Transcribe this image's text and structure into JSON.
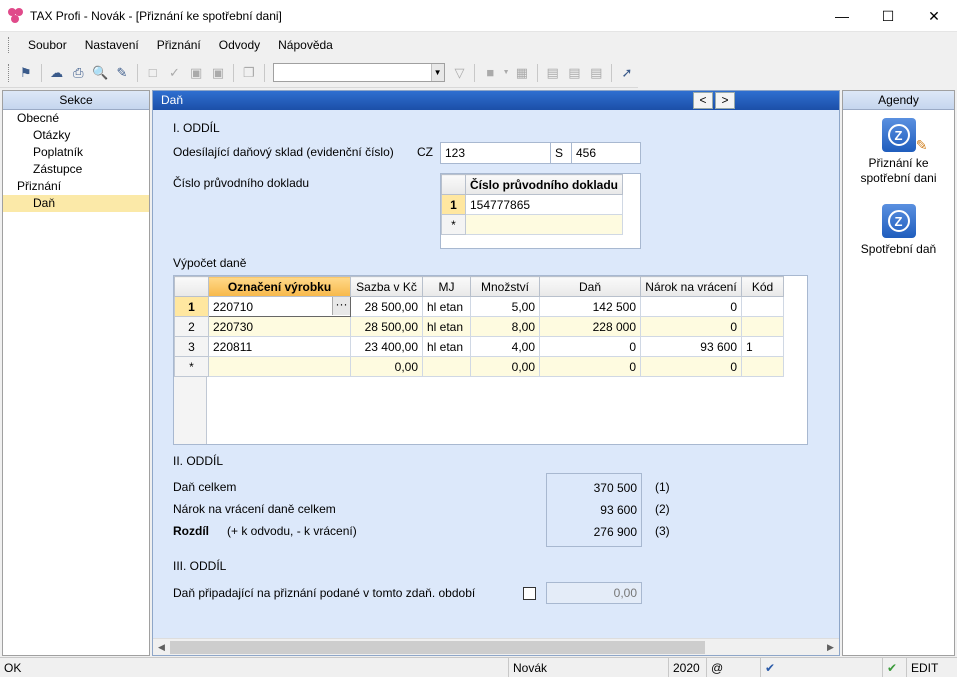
{
  "window": {
    "title": "TAX Profi - Novák - [Přiznání ke spotřební dani]"
  },
  "menu": [
    "Soubor",
    "Nastavení",
    "Přiznání",
    "Odvody",
    "Nápověda"
  ],
  "sidebar": {
    "header": "Sekce",
    "items": [
      {
        "label": "Obecné",
        "level": 1
      },
      {
        "label": "Otázky",
        "level": 2
      },
      {
        "label": "Poplatník",
        "level": 2
      },
      {
        "label": "Zástupce",
        "level": 2
      },
      {
        "label": "Přiznání",
        "level": 1
      },
      {
        "label": "Daň",
        "level": 2,
        "selected": true
      }
    ]
  },
  "main": {
    "header": "Daň",
    "section1": "I. ODDÍL",
    "sklad_label": "Odesílající daňový sklad (evidenční číslo)",
    "sklad_prefix": "CZ",
    "sklad_value": "123",
    "sklad_s_label": "S",
    "sklad_s_value": "456",
    "doklad_label": "Číslo průvodního dokladu",
    "doklad_table": {
      "header": "Číslo průvodního dokladu",
      "rows": [
        {
          "num": "1",
          "value": "154777865"
        }
      ],
      "new_row": "*"
    },
    "vypocet_label": "Výpočet daně",
    "tax_table": {
      "headers": [
        "Označení výrobku",
        "Sazba v Kč",
        "MJ",
        "Množství",
        "Daň",
        "Nárok na vrácení",
        "Kód"
      ],
      "rows": [
        {
          "num": "1",
          "product": "220710",
          "rate": "28 500,00",
          "unit": "hl etan",
          "qty": "5,00",
          "tax": "142 500",
          "refund": "0",
          "code": ""
        },
        {
          "num": "2",
          "product": "220730",
          "rate": "28 500,00",
          "unit": "hl etan",
          "qty": "8,00",
          "tax": "228 000",
          "refund": "0",
          "code": ""
        },
        {
          "num": "3",
          "product": "220811",
          "rate": "23 400,00",
          "unit": "hl etan",
          "qty": "4,00",
          "tax": "0",
          "refund": "93 600",
          "code": "1"
        }
      ],
      "new_row": {
        "num": "*",
        "rate": "0,00",
        "qty": "0,00",
        "tax": "0",
        "refund": "0"
      }
    },
    "section2": "II. ODDÍL",
    "dan_celkem_label": "Daň celkem",
    "dan_celkem_value": "370 500",
    "dan_celkem_ref": "(1)",
    "narok_label": "Nárok na vrácení daně celkem",
    "narok_value": "93 600",
    "narok_ref": "(2)",
    "rozdil_label": "Rozdíl",
    "rozdil_note": "(+ k odvodu, - k vrácení)",
    "rozdil_value": "276 900",
    "rozdil_ref": "(3)",
    "section3": "III. ODDÍL",
    "pripadajici_label": "Daň připadající na přiznání podané v tomto zdaň. období",
    "pripadajici_value": "0,00"
  },
  "agendy": {
    "header": "Agendy",
    "items": [
      "Přiznání ke spotřební dani",
      "Spotřební daň"
    ]
  },
  "statusbar": {
    "status": "OK",
    "user": "Novák",
    "year": "2020",
    "at": "@",
    "mode": "EDIT"
  }
}
